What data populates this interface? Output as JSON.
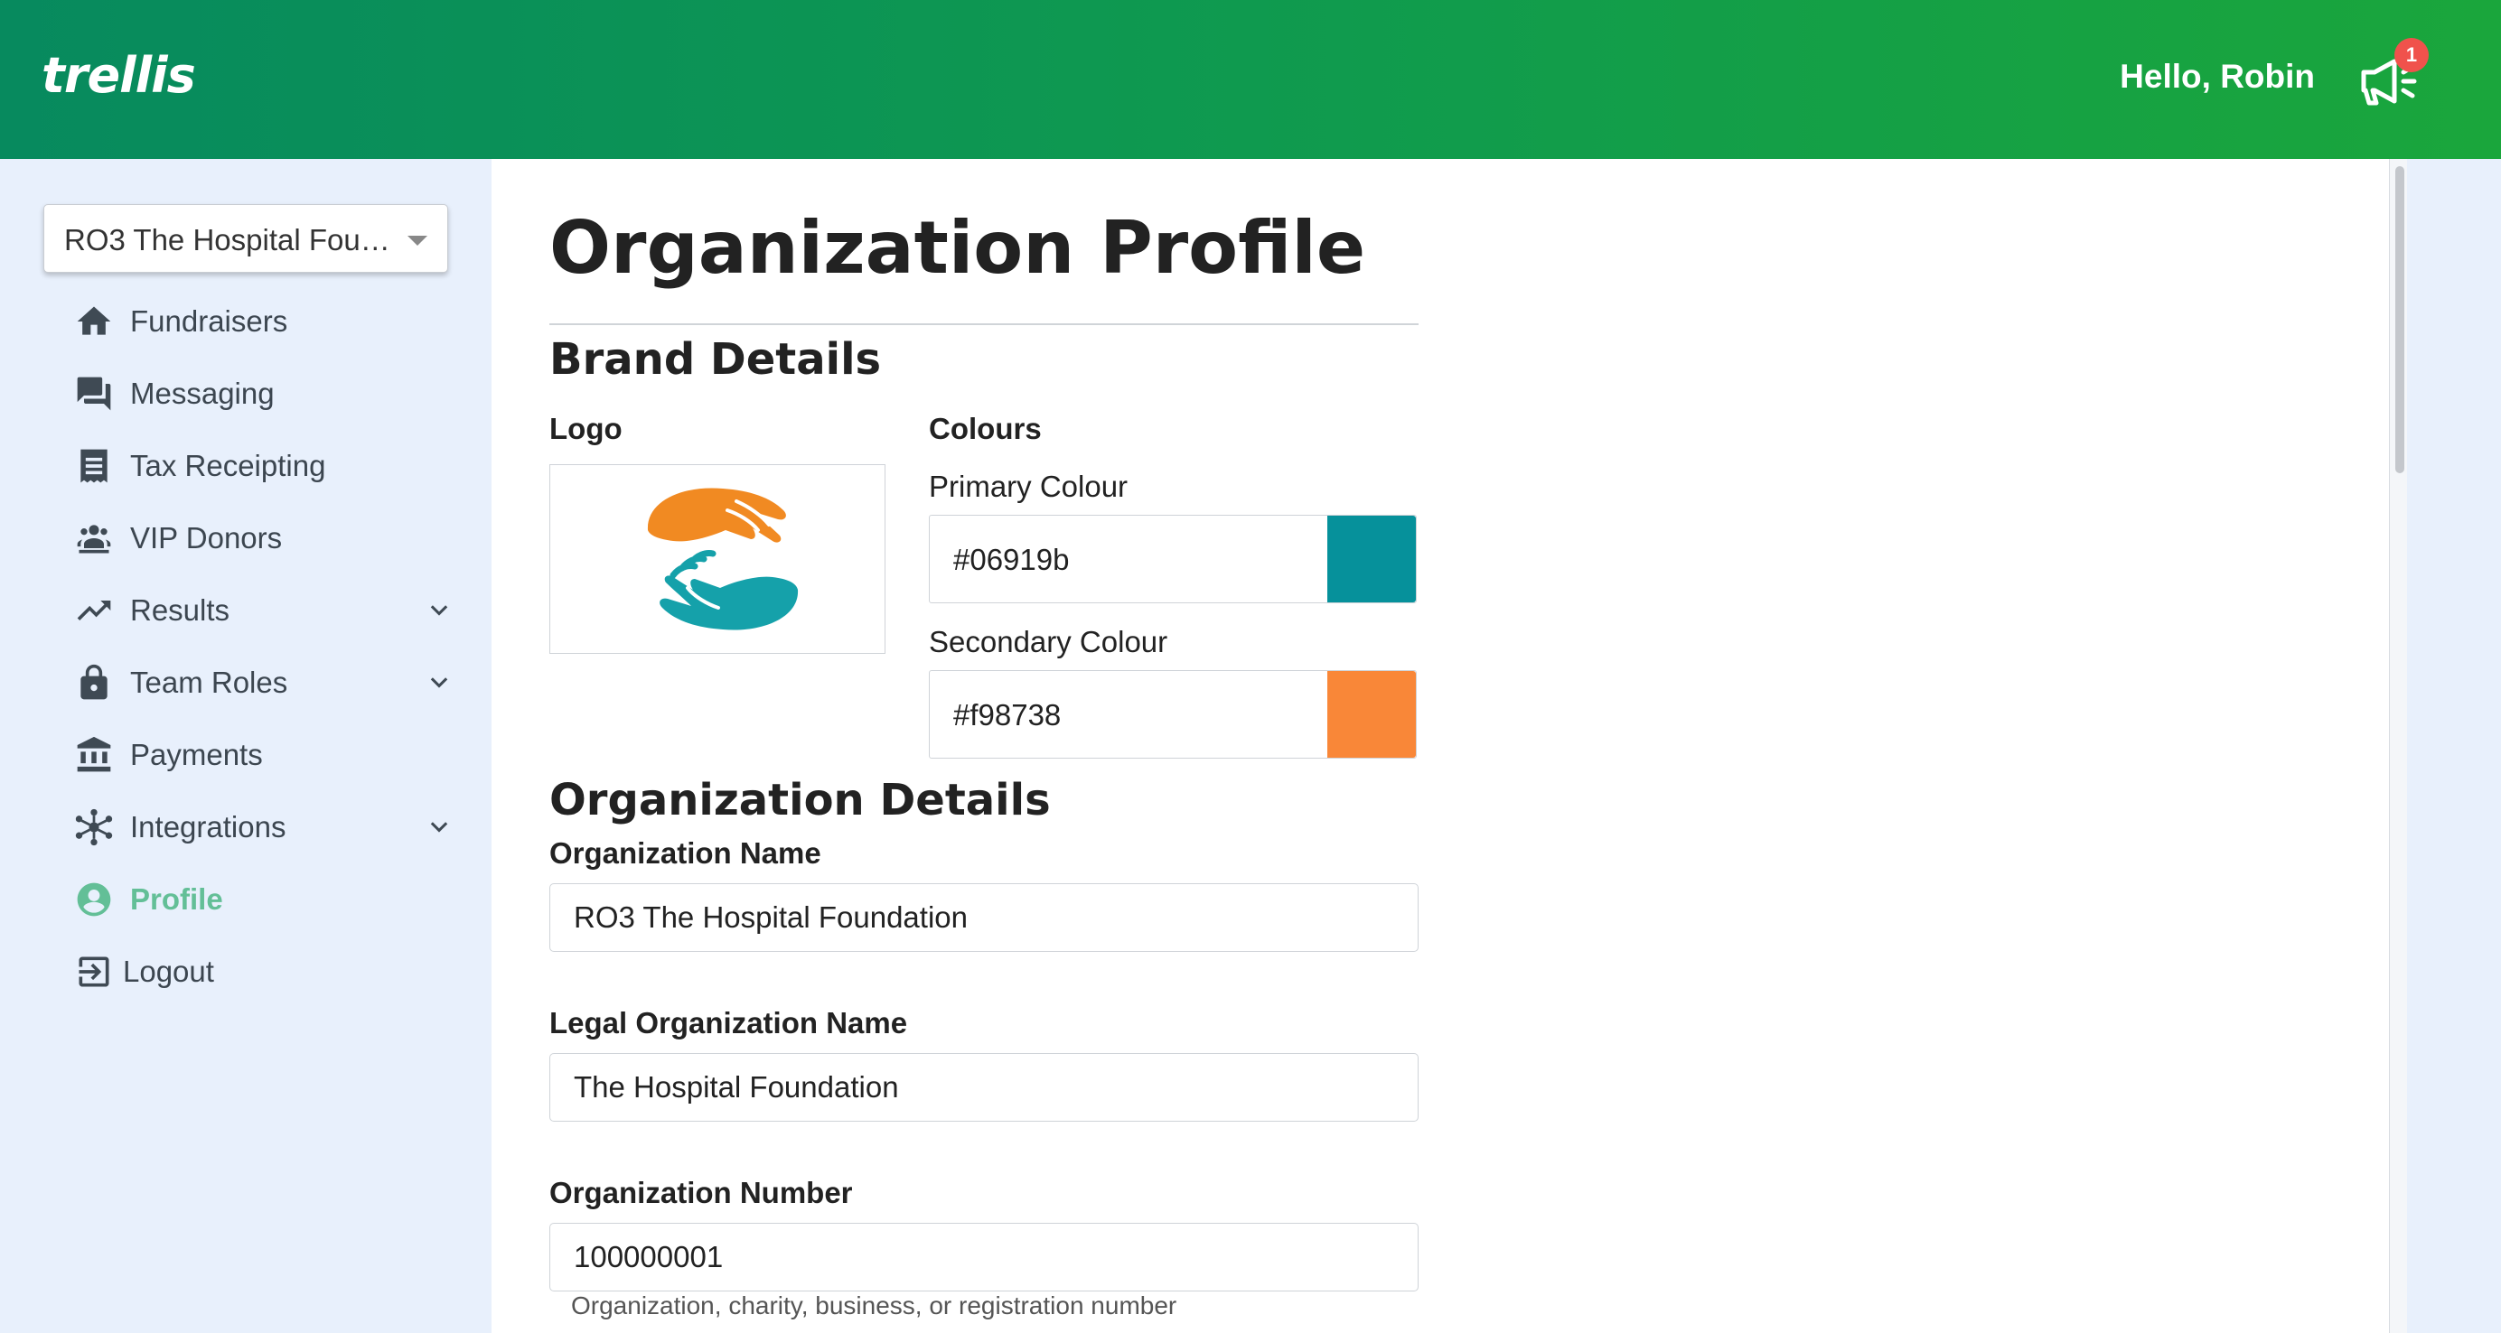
{
  "header": {
    "logo": "trellis",
    "greeting": "Hello, Robin",
    "notification_count": "1",
    "notification_icon": "megaphone-icon"
  },
  "sidebar": {
    "org_selector": "RO3 The Hospital Foundation",
    "items": [
      {
        "label": "Fundraisers",
        "icon": "home-icon",
        "expandable": false
      },
      {
        "label": "Messaging",
        "icon": "chat-icon",
        "expandable": false
      },
      {
        "label": "Tax Receipting",
        "icon": "receipt-icon",
        "expandable": false
      },
      {
        "label": "VIP Donors",
        "icon": "donors-icon",
        "expandable": false
      },
      {
        "label": "Results",
        "icon": "trending-icon",
        "expandable": true
      },
      {
        "label": "Team Roles",
        "icon": "lock-icon",
        "expandable": true
      },
      {
        "label": "Payments",
        "icon": "bank-icon",
        "expandable": false
      },
      {
        "label": "Integrations",
        "icon": "hub-icon",
        "expandable": true
      },
      {
        "label": "Profile",
        "icon": "profile-icon",
        "expandable": false,
        "active": true
      },
      {
        "label": "Logout",
        "icon": "logout-icon",
        "expandable": false
      }
    ]
  },
  "main": {
    "title": "Organization Profile",
    "brand": {
      "heading": "Brand Details",
      "logo_label": "Logo",
      "colours_label": "Colours",
      "primary_label": "Primary Colour",
      "primary_value": "#06919b",
      "secondary_label": "Secondary Colour",
      "secondary_value": "#f98738"
    },
    "org": {
      "heading": "Organization Details",
      "name_label": "Organization Name",
      "name_value": "RO3 The Hospital Foundation",
      "legal_label": "Legal Organization Name",
      "legal_value": "The Hospital Foundation",
      "number_label": "Organization Number",
      "number_value": "100000001",
      "number_hint": "Organization, charity, business, or registration number"
    }
  },
  "colors": {
    "header_start": "#078a5e",
    "header_end": "#1aa63c",
    "active_nav": "#63bf97",
    "primary": "#06919b",
    "secondary": "#f98738"
  }
}
